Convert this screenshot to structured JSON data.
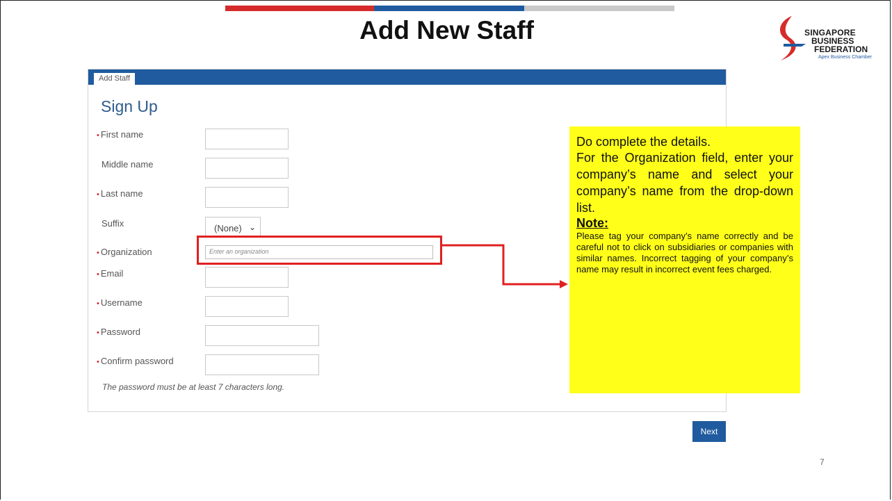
{
  "slide": {
    "title": "Add New Staff",
    "page_number": "7",
    "accent_colors": [
      "#d62b2b",
      "#1f5b9e",
      "#c9c9c9"
    ]
  },
  "logo": {
    "line1": "SINGAPORE",
    "line2": "BUSINESS",
    "line3": "FEDERATION",
    "tagline": "Apex Business Chamber"
  },
  "form": {
    "tab_label": "Add Staff",
    "heading": "Sign Up",
    "fields": {
      "first_name": {
        "label": "First name",
        "value": ""
      },
      "middle_name": {
        "label": "Middle name",
        "value": ""
      },
      "last_name": {
        "label": "Last name",
        "value": ""
      },
      "suffix": {
        "label": "Suffix",
        "selected": "(None)"
      },
      "organization": {
        "label": "Organization",
        "placeholder": "Enter an organization"
      },
      "email": {
        "label": "Email",
        "value": ""
      },
      "username": {
        "label": "Username",
        "value": ""
      },
      "password": {
        "label": "Password",
        "value": ""
      },
      "confirm_password": {
        "label": "Confirm password",
        "value": ""
      }
    },
    "password_hint": "The password must be at least 7 characters long.",
    "next_label": "Next"
  },
  "callout": {
    "intro": "Do complete the details.",
    "body": "For the Organization field, enter your company’s name and select your company’s name from the drop-down list.",
    "note_title": "Note:",
    "note_text": "Please tag your company’s name correctly and be careful not to click on subsidiaries or companies with similar names. Incorrect tagging of your company’s name may result in incorrect event fees charged."
  }
}
